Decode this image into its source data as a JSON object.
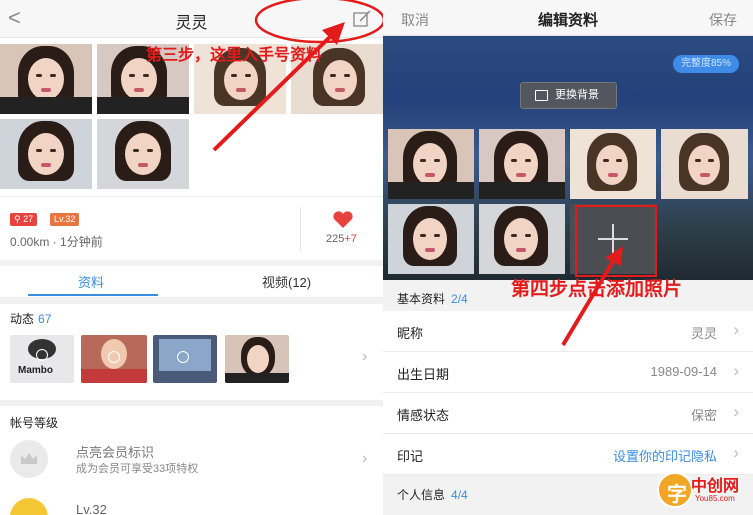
{
  "left": {
    "nav": {
      "back_glyph": "<",
      "title": "灵灵",
      "edit_icon": "edit-icon"
    },
    "annotation_step3": "第三步，这里入手号资料",
    "badges": {
      "rank": "27",
      "level": "Lv.32",
      "rank_color": "#e8423f",
      "level_color": "#e8753f"
    },
    "distance_time": "0.00km · 1分钟前",
    "likes": {
      "count": "225",
      "plus": "+7"
    },
    "tabs": [
      {
        "label": "资料",
        "active": true
      },
      {
        "label": "视频(12)",
        "active": false
      }
    ],
    "dynamics": {
      "label": "动态",
      "count": "67",
      "thumb_text": "Mambo"
    },
    "account_level": {
      "title": "帐号等级",
      "member_line1": "点亮会员标识",
      "member_line2": "成为会员可享受33项特权",
      "level_label": "Lv.32"
    }
  },
  "right": {
    "nav": {
      "cancel": "取消",
      "title": "编辑资料",
      "save": "保存"
    },
    "completeness": "完整度85%",
    "change_background": "更换背景",
    "annotation_step4": "第四步点击添加照片",
    "basic_section": {
      "label": "基本资料",
      "fraction": "2/4"
    },
    "rows": [
      {
        "key": "昵称",
        "value": "灵灵",
        "accent": false
      },
      {
        "key": "出生日期",
        "value": "1989-09-14",
        "accent": false
      },
      {
        "key": "情感状态",
        "value": "保密",
        "accent": false
      },
      {
        "key": "印记",
        "value": "设置你的印记隐私",
        "accent": true
      }
    ],
    "personal_section": {
      "label": "个人信息",
      "fraction": "4/4"
    }
  },
  "watermark": {
    "logo_glyph": "字",
    "name": "中创网",
    "domain": "You85.com"
  },
  "colors": {
    "accent_blue": "#3a8de0",
    "annotation_red": "#e31b1b",
    "heart_red": "#e8423f"
  }
}
